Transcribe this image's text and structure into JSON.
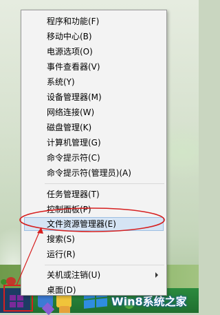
{
  "context_menu": {
    "items": [
      {
        "label": "程序和功能(F)"
      },
      {
        "label": "移动中心(B)"
      },
      {
        "label": "电源选项(O)"
      },
      {
        "label": "事件查看器(V)"
      },
      {
        "label": "系统(Y)"
      },
      {
        "label": "设备管理器(M)"
      },
      {
        "label": "网络连接(W)"
      },
      {
        "label": "磁盘管理(K)"
      },
      {
        "label": "计算机管理(G)"
      },
      {
        "label": "命令提示符(C)"
      },
      {
        "label": "命令提示符(管理员)(A)"
      },
      {
        "label": "任务管理器(T)"
      },
      {
        "label": "控制面板(P)"
      },
      {
        "label": "文件资源管理器(E)",
        "selected": true
      },
      {
        "label": "搜索(S)"
      },
      {
        "label": "运行(R)"
      },
      {
        "label": "关机或注销(U)",
        "has_submenu": true
      },
      {
        "label": "桌面(D)"
      }
    ]
  },
  "taskbar": {
    "start_icon": "windows-logo-icon"
  },
  "watermark": {
    "text": "Win8系统之家"
  },
  "annotation": {
    "color": "#d62020"
  }
}
